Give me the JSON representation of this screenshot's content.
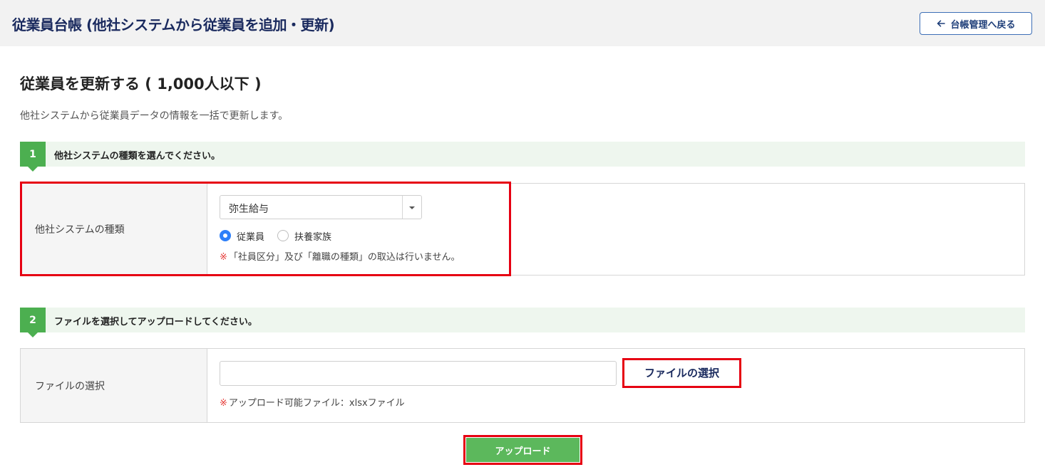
{
  "header": {
    "title": "従業員台帳 (他社システムから従業員を追加・更新)",
    "back_button_label": "台帳管理へ戻る"
  },
  "section": {
    "title": "従業員を更新する ( 1,000人以下 )",
    "description": "他社システムから従業員データの情報を一括で更新します。"
  },
  "step1": {
    "number": "1",
    "label": "他社システムの種類を選んでください。",
    "field_label": "他社システムの種類",
    "select_value": "弥生給与",
    "radios": [
      {
        "label": "従業員",
        "checked": true
      },
      {
        "label": "扶養家族",
        "checked": false
      }
    ],
    "note_mark": "※",
    "note": "「社員区分」及び「離職の種類」の取込は行いません。"
  },
  "step2": {
    "number": "2",
    "label": "ファイルを選択してアップロードしてください。",
    "field_label": "ファイルの選択",
    "file_value": "",
    "select_button_label": "ファイルの選択",
    "note_mark": "※",
    "note": "アップロード可能ファイル：xlsxファイル"
  },
  "upload_button_label": "アップロード",
  "colors": {
    "accent_green": "#5cb85c",
    "highlight_red": "#e60012",
    "radio_blue": "#2d7ff9"
  }
}
